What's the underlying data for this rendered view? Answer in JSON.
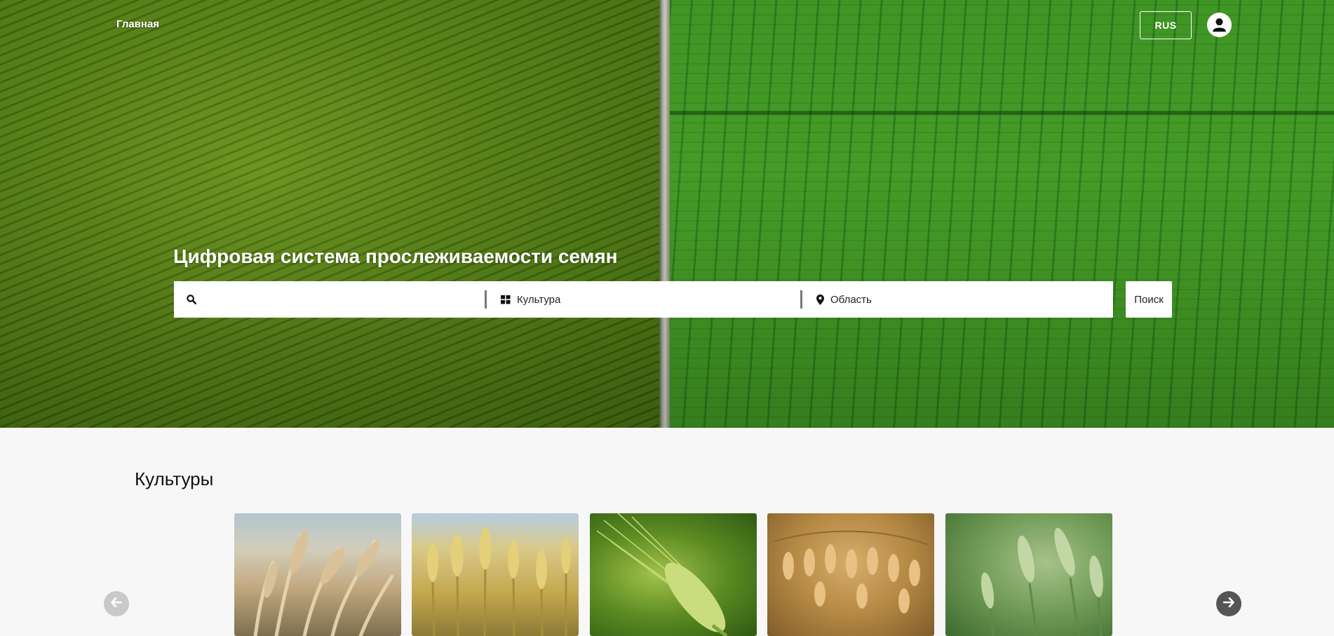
{
  "nav": {
    "home_label": "Главная",
    "lang_label": "RUS"
  },
  "hero": {
    "title": "Цифровая система прослеживаемости семян"
  },
  "search": {
    "query_placeholder": "",
    "culture_label": "Культура",
    "region_label": "Область",
    "submit_label": "Поиск"
  },
  "cultures": {
    "title": "Культуры",
    "cards": [
      {
        "icon": "barley-photo"
      },
      {
        "icon": "wheat-photo"
      },
      {
        "icon": "green-wheat-ear-photo"
      },
      {
        "icon": "oats-photo"
      },
      {
        "icon": "green-wheat-field-photo"
      }
    ]
  },
  "colors": {
    "hero_field_left": "#5d8d18",
    "hero_field_right": "#44a022",
    "page_background": "#f7f7f7",
    "arrow_prev": "#c9c9c9",
    "arrow_next": "#555555"
  }
}
